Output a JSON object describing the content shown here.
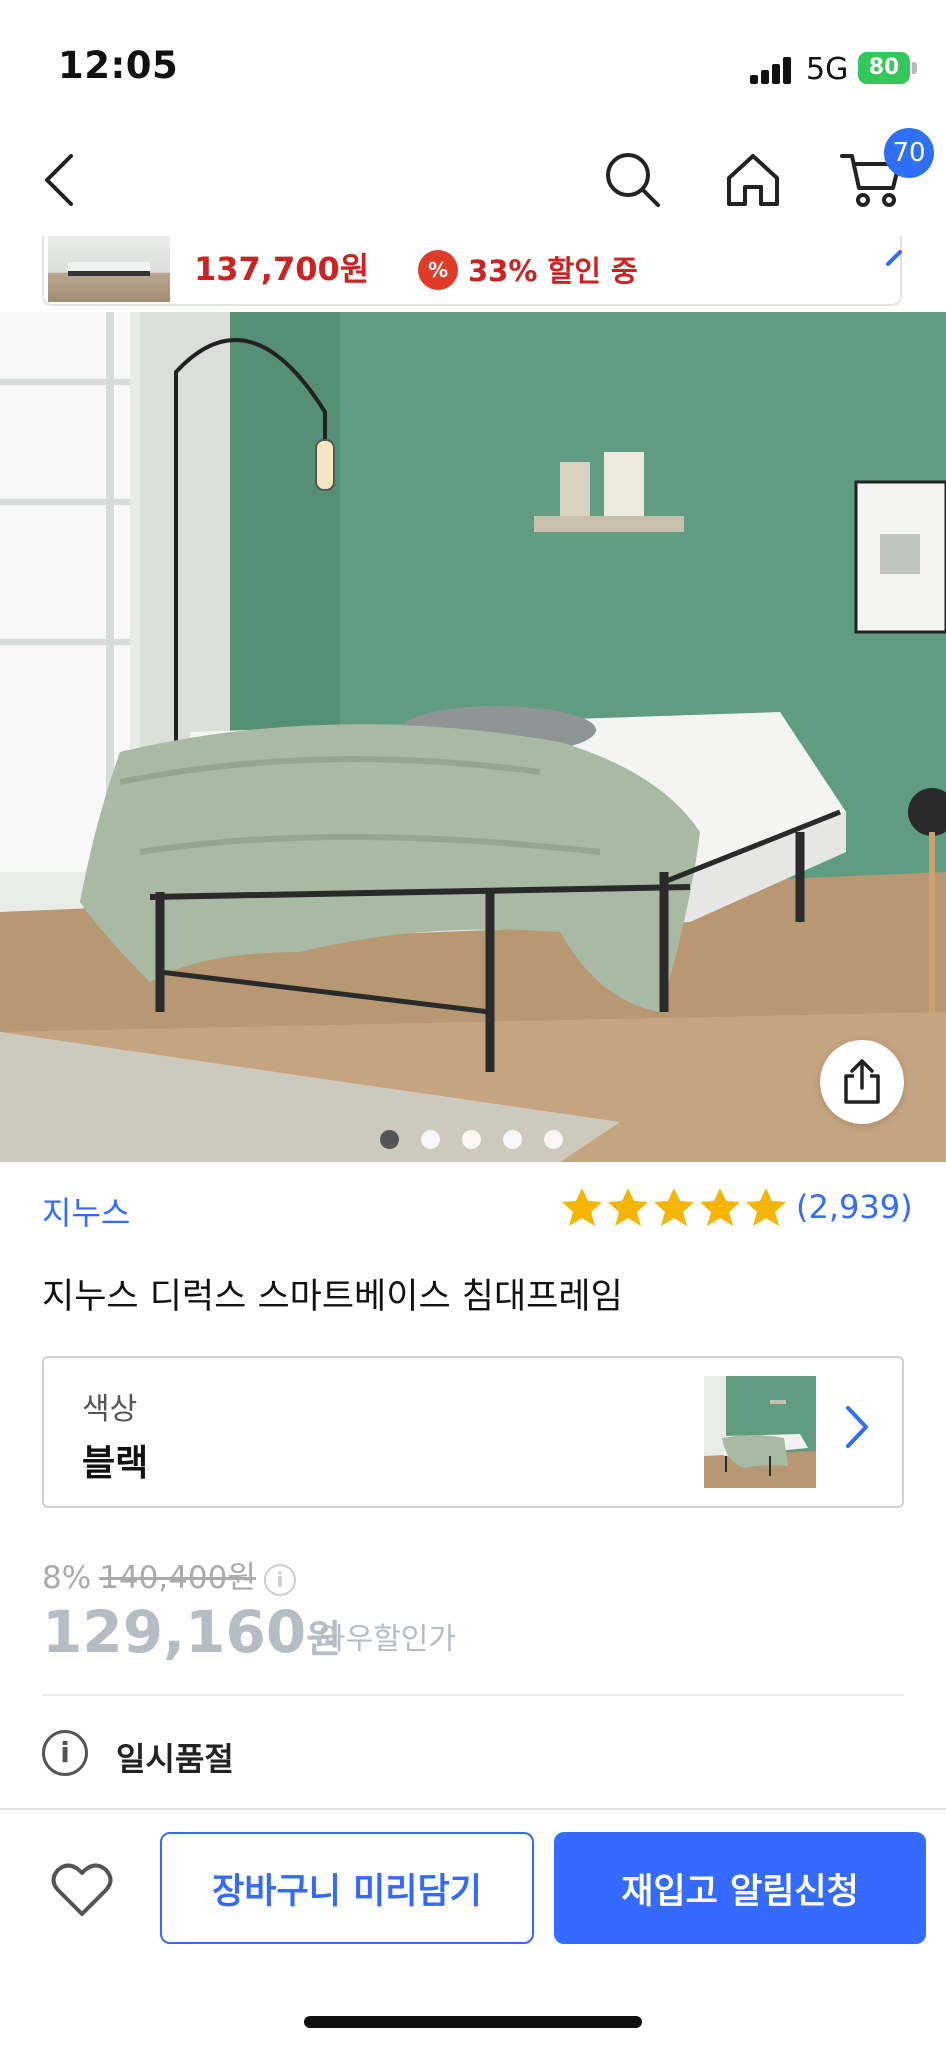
{
  "status_bar": {
    "time": "12:05",
    "network": "5G",
    "battery": "80"
  },
  "topnav": {
    "cart_count": "70"
  },
  "mini_banner": {
    "price": "137,700원",
    "percent_symbol": "%",
    "discount_text": "33% 할인 중"
  },
  "gallery": {
    "total_slides": 5,
    "active_slide": 1
  },
  "product": {
    "brand": "지누스",
    "rating_count": "(2,939)",
    "stars": 5,
    "title": "지누스 디럭스 스마트베이스 침대프레임"
  },
  "option": {
    "label": "색상",
    "value": "블랙"
  },
  "pricing": {
    "discount_percent": "8%",
    "original_price": "140,400원",
    "info_symbol": "i",
    "price_number": "129,160",
    "price_unit": "원",
    "wow_label": "와우할인가"
  },
  "stock": {
    "info_symbol": "i",
    "status": "일시품절"
  },
  "bottom_bar": {
    "cart_button": "장바구니 미리담기",
    "notify_button": "재입고 알림신청"
  },
  "colors": {
    "accent": "#346aff",
    "discount_red": "#cc2222",
    "badge_blue": "#2f6ff5",
    "star": "#f5b400",
    "wall_green": "#5f9c80"
  }
}
